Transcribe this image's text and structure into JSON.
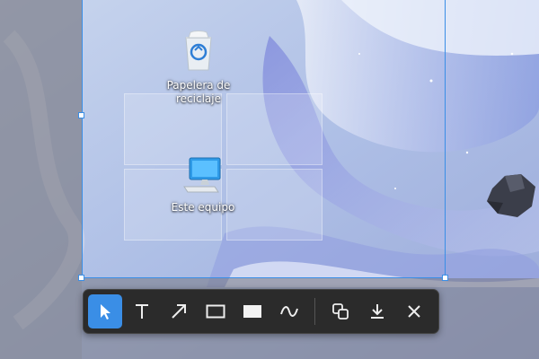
{
  "desktop": {
    "icons": [
      {
        "label": "Papelera de reciclaje",
        "icon": "recycle-bin-icon"
      },
      {
        "label": "Este equipo",
        "icon": "computer-icon"
      }
    ]
  },
  "toolbar": {
    "tools": [
      {
        "icon": "select-arrow-icon",
        "active": true
      },
      {
        "icon": "text-tool-icon"
      },
      {
        "icon": "arrow-tool-icon"
      },
      {
        "icon": "rectangle-outline-icon"
      },
      {
        "icon": "rectangle-filled-icon"
      },
      {
        "icon": "freehand-pen-icon"
      },
      {
        "icon": "copy-icon"
      },
      {
        "icon": "download-icon"
      },
      {
        "icon": "close-icon"
      }
    ],
    "accent": "#3a8ee6"
  }
}
